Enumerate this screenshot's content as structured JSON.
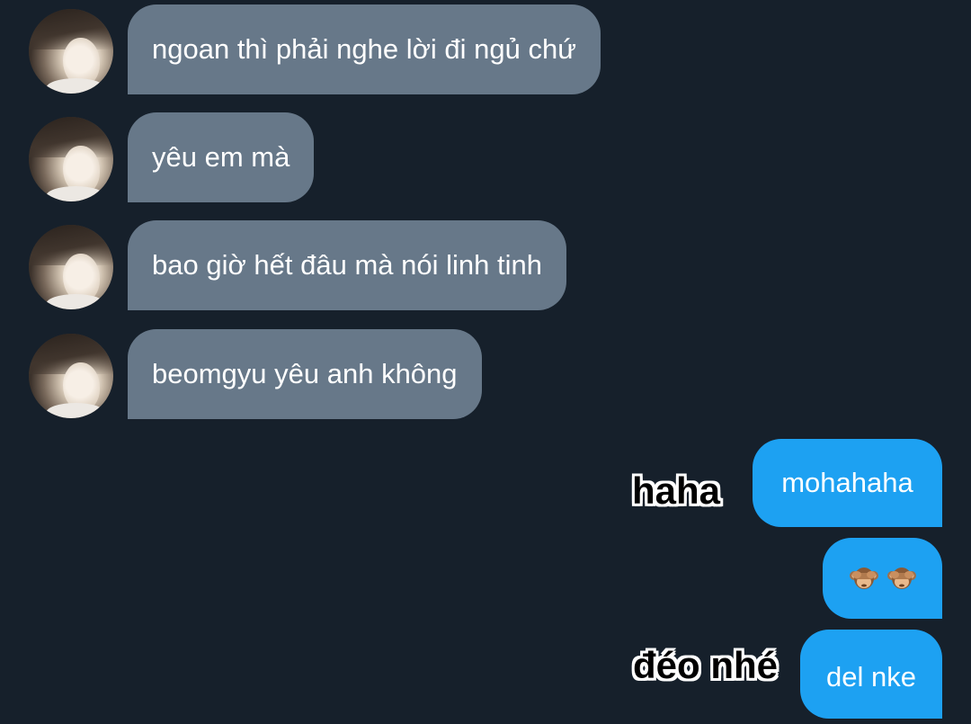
{
  "messages_in": [
    {
      "text": "ngoan thì phải nghe lời đi ngủ chứ"
    },
    {
      "text": "yêu em mà"
    },
    {
      "text": "bao giờ hết đâu mà nói linh tinh"
    },
    {
      "text": "beomgyu yêu anh không"
    }
  ],
  "messages_out": [
    {
      "text": "mohahaha"
    },
    {
      "text": "",
      "emoji": [
        "see-no-evil-monkey",
        "see-no-evil-monkey"
      ]
    },
    {
      "text": "del nke"
    }
  ],
  "overlays": [
    {
      "text": "haha"
    },
    {
      "text": "đéo nhé"
    }
  ],
  "colors": {
    "background": "#16202b",
    "incoming_bubble": "#677889",
    "outgoing_bubble": "#1da1f2"
  }
}
